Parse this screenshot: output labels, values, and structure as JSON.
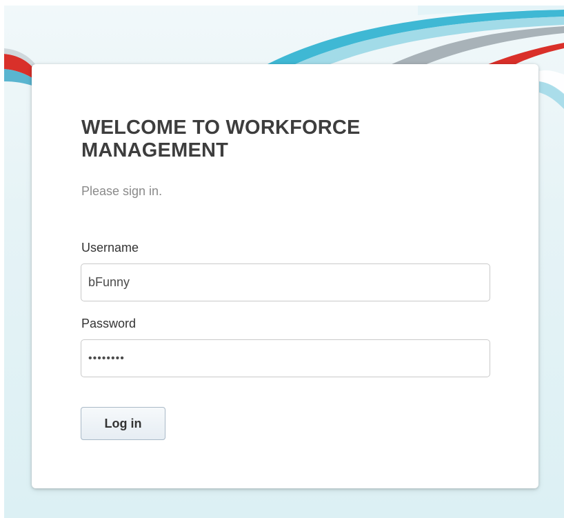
{
  "login": {
    "title": "WELCOME TO WORKFORCE MANAGEMENT",
    "subtitle": "Please sign in.",
    "username_label": "Username",
    "username_value": "bFunny",
    "password_label": "Password",
    "password_value": "••••••••",
    "login_button": "Log in"
  },
  "colors": {
    "background": "#e6f3f6",
    "swoosh_teal": "#3fb8d4",
    "swoosh_red": "#d9302a",
    "title_text": "#3d3d3d",
    "button_border": "#a9b9c7"
  },
  "icons": [
    "background-swoosh"
  ]
}
